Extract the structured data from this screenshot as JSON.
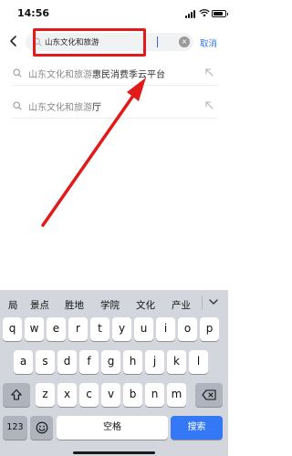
{
  "status": {
    "time": "14:56"
  },
  "search": {
    "query": "山东文化和旅游",
    "cancel_label": "取消"
  },
  "suggestions": [
    {
      "prefix": "山东文化和旅游",
      "suffix": "惠民消费季云平台"
    },
    {
      "prefix": "山东文化和旅游",
      "suffix": "厅"
    }
  ],
  "keyboard": {
    "candidates": [
      "局",
      "景点",
      "胜地",
      "学院",
      "文化",
      "产业"
    ],
    "row1": [
      "q",
      "w",
      "e",
      "r",
      "t",
      "y",
      "u",
      "i",
      "o",
      "p"
    ],
    "row2": [
      "a",
      "s",
      "d",
      "f",
      "g",
      "h",
      "j",
      "k",
      "l"
    ],
    "row3": [
      "z",
      "x",
      "c",
      "v",
      "b",
      "n",
      "m"
    ],
    "num_label": "123",
    "space_label": "空格",
    "search_label": "搜索"
  },
  "colors": {
    "accent": "#3478f6",
    "highlight": "#e11a1a",
    "keyboard_bg": "#d3d6dc"
  }
}
